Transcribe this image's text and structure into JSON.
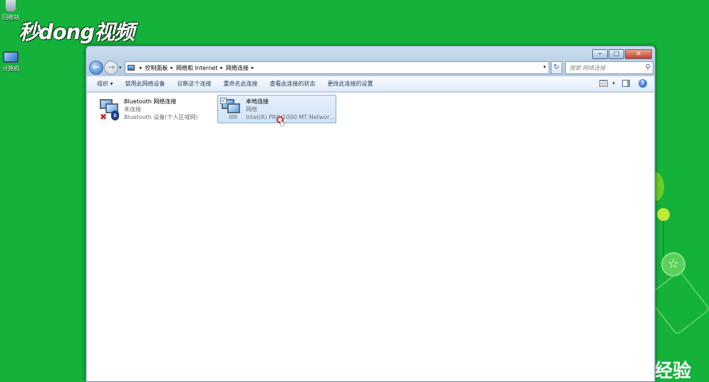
{
  "desktop": {
    "icons": [
      {
        "label": "回收站"
      },
      {
        "label": "计算机"
      }
    ],
    "watermark": "秒dong视频",
    "corner_text": "经验"
  },
  "window": {
    "controls": {
      "minimize": "–",
      "maximize": "□",
      "close": "✕"
    },
    "nav": {
      "back": "←",
      "forward": "→",
      "history": "▾"
    },
    "breadcrumb": [
      "控制面板",
      "网络和 Internet",
      "网络连接"
    ],
    "address_dropdown": "▾",
    "refresh": "↻",
    "search": {
      "placeholder": "搜索 网络连接"
    },
    "toolbar": {
      "items": [
        "组织 ▾",
        "禁用此网络设备",
        "诊断这个连接",
        "重命名此连接",
        "查看此连接的状态",
        "更改此连接的设置"
      ],
      "view_caret": "▾",
      "help": "?"
    },
    "connections": [
      {
        "name": "Bluetooth 网络连接",
        "status": "未连接",
        "device": "Bluetooth 设备(个人区域网)",
        "icon": "bluetooth-network-icon",
        "selected": false
      },
      {
        "name": "本地连接",
        "status": "网络",
        "device": "Intel(R) PRO/1000 MT Networ...",
        "icon": "lan-network-icon",
        "selected": true
      }
    ]
  }
}
